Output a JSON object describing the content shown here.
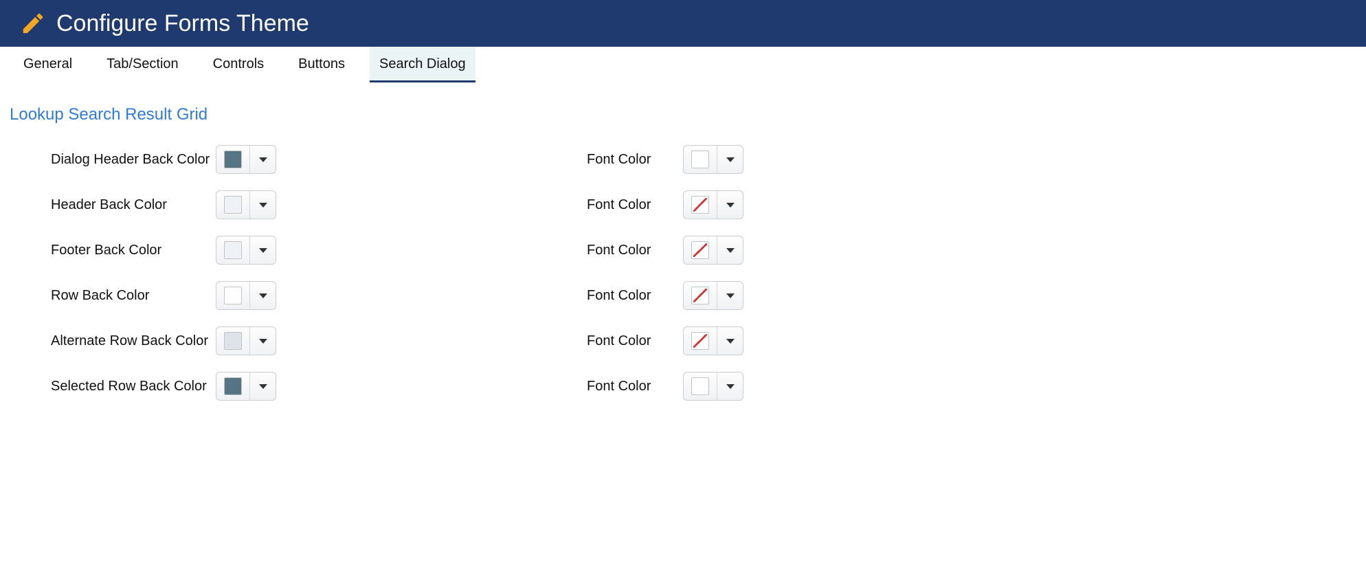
{
  "header": {
    "title": "Configure Forms Theme"
  },
  "tabs": [
    {
      "label": "General",
      "active": false
    },
    {
      "label": "Tab/Section",
      "active": false
    },
    {
      "label": "Controls",
      "active": false
    },
    {
      "label": "Buttons",
      "active": false
    },
    {
      "label": "Search Dialog",
      "active": true
    }
  ],
  "section": {
    "title": "Lookup Search Result Grid"
  },
  "rows": [
    {
      "left_label": "Dialog Header Back Color",
      "left_color": "#557584",
      "right_label": "Font Color",
      "right_color": "#ffffff",
      "right_none": false
    },
    {
      "left_label": "Header Back Color",
      "left_color": "#eef2f6",
      "right_label": "Font Color",
      "right_color": "",
      "right_none": true
    },
    {
      "left_label": "Footer Back Color",
      "left_color": "#eef2f6",
      "right_label": "Font Color",
      "right_color": "",
      "right_none": true
    },
    {
      "left_label": "Row Back Color",
      "left_color": "#ffffff",
      "right_label": "Font Color",
      "right_color": "",
      "right_none": true
    },
    {
      "left_label": "Alternate Row Back Color",
      "left_color": "#dde3e8",
      "right_label": "Font Color",
      "right_color": "",
      "right_none": true
    },
    {
      "left_label": "Selected Row Back Color",
      "left_color": "#557584",
      "right_label": "Font Color",
      "right_color": "#ffffff",
      "right_none": false
    }
  ]
}
